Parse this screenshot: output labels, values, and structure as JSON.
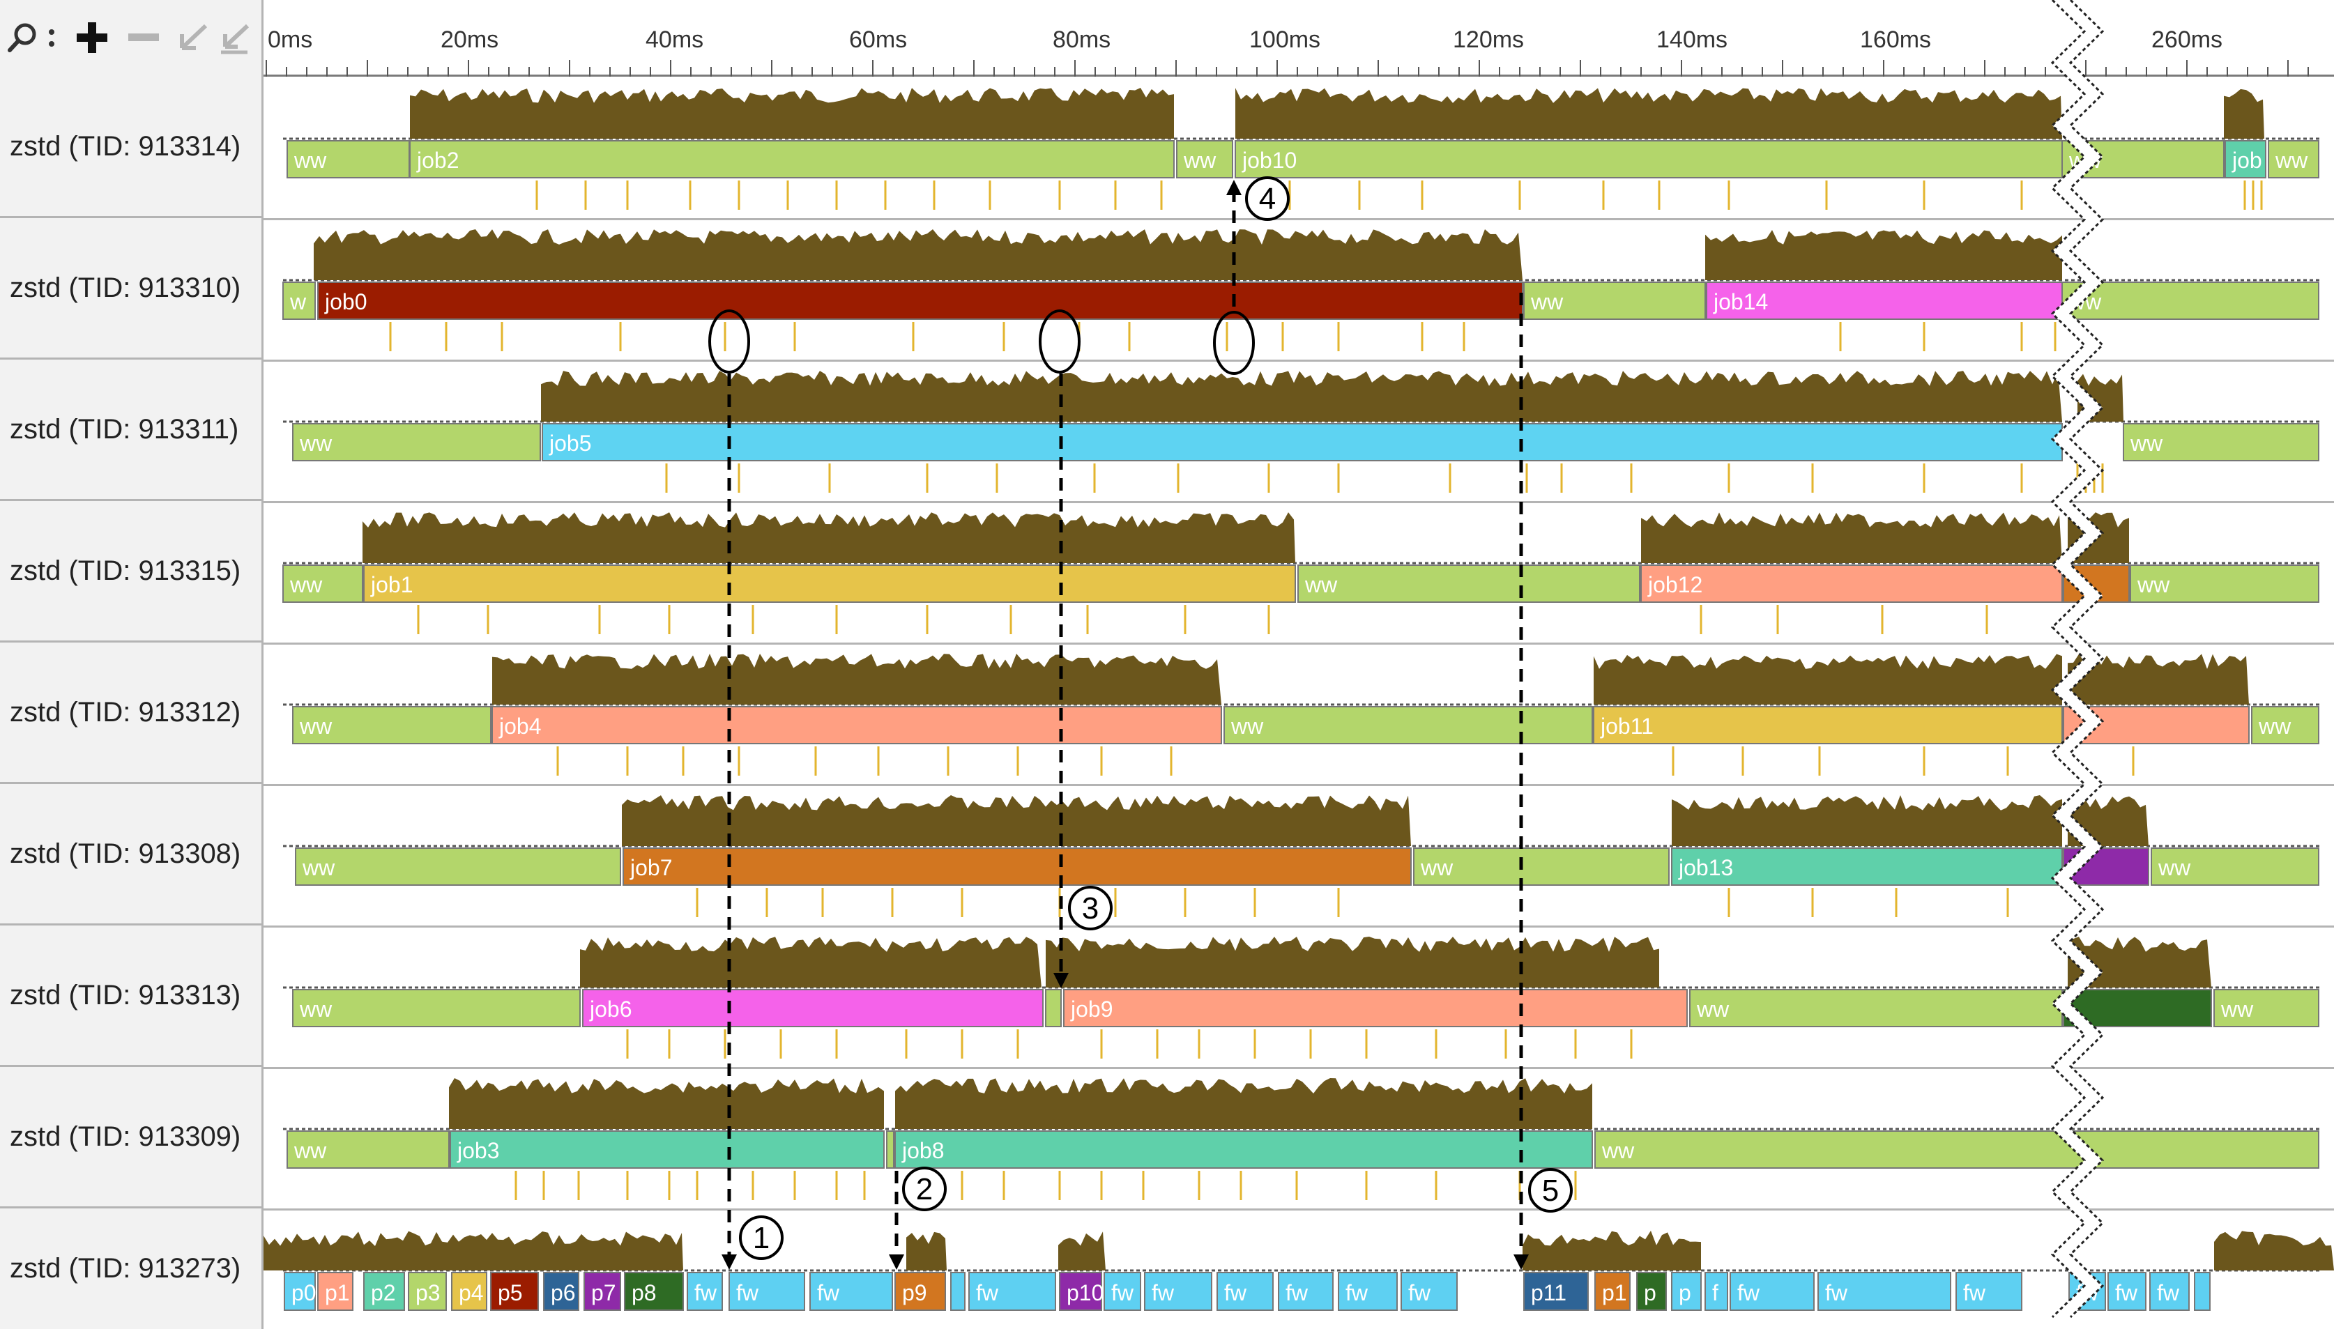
{
  "toolbar": {
    "tools": [
      {
        "name": "search-icon"
      },
      {
        "name": "colon-icon"
      },
      {
        "name": "zoom-in-icon"
      },
      {
        "name": "zoom-out-icon"
      },
      {
        "name": "undo-zoom-icon"
      },
      {
        "name": "reset-zoom-icon"
      }
    ]
  },
  "ruler": {
    "ticks": [
      "0ms",
      "20ms",
      "40ms",
      "60ms",
      "80ms",
      "100ms",
      "120ms",
      "140ms",
      "160ms",
      "260ms"
    ]
  },
  "colors": {
    "ww": "#b3d66b",
    "fw": "#5ed0f2",
    "activity": "#6b561c",
    "event_tick": "#e3b52e",
    "job0": "#9b1c00",
    "job1": "#e6c44a",
    "job2": "#b3d66b",
    "job3": "#5fd0aa",
    "job4": "#ff9f82",
    "job5": "#5ed3f2",
    "job6": "#f562ea",
    "job7": "#d27620",
    "job8": "#5fd0aa",
    "job9": "#ff9f82",
    "job10": "#b3d66b",
    "job11": "#e6c44a",
    "job12": "#ff9f82",
    "job13": "#5fd0aa",
    "job14": "#f562ea"
  },
  "lanes": [
    {
      "label": "zstd (TID: 913314)",
      "segments": [
        {
          "text": "ww",
          "color": "#b3d66b"
        },
        {
          "text": "job2",
          "color": "#b3d66b"
        },
        {
          "text": "ww",
          "color": "#b3d66b"
        },
        {
          "text": "job10",
          "color": "#b3d66b"
        },
        {
          "text": "ww",
          "color": "#b3d66b"
        },
        {
          "text": "job",
          "color": "#5fd0aa"
        },
        {
          "text": "ww",
          "color": "#b3d66b"
        }
      ]
    },
    {
      "label": "zstd (TID: 913310)",
      "segments": [
        {
          "text": "w",
          "color": "#b3d66b"
        },
        {
          "text": "job0",
          "color": "#9b1c00"
        },
        {
          "text": "ww",
          "color": "#b3d66b"
        },
        {
          "text": "job14",
          "color": "#f562ea"
        },
        {
          "text": "ww",
          "color": "#b3d66b"
        }
      ]
    },
    {
      "label": "zstd (TID: 913311)",
      "segments": [
        {
          "text": "ww",
          "color": "#b3d66b"
        },
        {
          "text": "job5",
          "color": "#5ed3f2"
        },
        {
          "text": "ww",
          "color": "#b3d66b"
        }
      ]
    },
    {
      "label": "zstd (TID: 913315)",
      "segments": [
        {
          "text": "ww",
          "color": "#b3d66b"
        },
        {
          "text": "job1",
          "color": "#e6c44a"
        },
        {
          "text": "ww",
          "color": "#b3d66b"
        },
        {
          "text": "job12",
          "color": "#ff9f82"
        },
        {
          "text": "",
          "color": "#d27620"
        },
        {
          "text": "ww",
          "color": "#b3d66b"
        }
      ]
    },
    {
      "label": "zstd (TID: 913312)",
      "segments": [
        {
          "text": "ww",
          "color": "#b3d66b"
        },
        {
          "text": "job4",
          "color": "#ff9f82"
        },
        {
          "text": "ww",
          "color": "#b3d66b"
        },
        {
          "text": "job11",
          "color": "#e6c44a"
        },
        {
          "text": "",
          "color": "#ff9f82"
        },
        {
          "text": "ww",
          "color": "#b3d66b"
        }
      ]
    },
    {
      "label": "zstd (TID: 913308)",
      "segments": [
        {
          "text": "ww",
          "color": "#b3d66b"
        },
        {
          "text": "job7",
          "color": "#d27620"
        },
        {
          "text": "ww",
          "color": "#b3d66b"
        },
        {
          "text": "job13",
          "color": "#5fd0aa"
        },
        {
          "text": "",
          "color": "#8e2aa8"
        },
        {
          "text": "ww",
          "color": "#b3d66b"
        }
      ]
    },
    {
      "label": "zstd (TID: 913313)",
      "segments": [
        {
          "text": "ww",
          "color": "#b3d66b"
        },
        {
          "text": "job6",
          "color": "#f562ea"
        },
        {
          "text": "",
          "color": "#b3d66b"
        },
        {
          "text": "job9",
          "color": "#ff9f82"
        },
        {
          "text": "ww",
          "color": "#b3d66b"
        },
        {
          "text": "",
          "color": "#2e6b24"
        },
        {
          "text": "ww",
          "color": "#b3d66b"
        }
      ]
    },
    {
      "label": "zstd (TID: 913309)",
      "segments": [
        {
          "text": "ww",
          "color": "#b3d66b"
        },
        {
          "text": "job3",
          "color": "#5fd0aa"
        },
        {
          "text": "",
          "color": "#b3d66b"
        },
        {
          "text": "job8",
          "color": "#5fd0aa"
        },
        {
          "text": "ww",
          "color": "#b3d66b"
        }
      ]
    },
    {
      "label": "zstd (TID: 913273)",
      "segments": [
        {
          "text": "p0",
          "color": "#5ed0f2"
        },
        {
          "text": "p1",
          "color": "#ff9f82"
        },
        {
          "text": "p2",
          "color": "#5fd0aa"
        },
        {
          "text": "p3",
          "color": "#b3d66b"
        },
        {
          "text": "p4",
          "color": "#e6c44a"
        },
        {
          "text": "p5",
          "color": "#9b1c00"
        },
        {
          "text": "p6",
          "color": "#2e6496"
        },
        {
          "text": "p7",
          "color": "#8e2aa8"
        },
        {
          "text": "p8",
          "color": "#2e6b24"
        },
        {
          "text": "fw",
          "color": "#5ed0f2"
        },
        {
          "text": "fw",
          "color": "#5ed0f2"
        },
        {
          "text": "fw",
          "color": "#5ed0f2"
        },
        {
          "text": "p9",
          "color": "#d27620"
        },
        {
          "text": "",
          "color": "#5ed0f2"
        },
        {
          "text": "fw",
          "color": "#5ed0f2"
        },
        {
          "text": "p10",
          "color": "#8e2aa8"
        },
        {
          "text": "fw",
          "color": "#5ed0f2"
        },
        {
          "text": "fw",
          "color": "#5ed0f2"
        },
        {
          "text": "fw",
          "color": "#5ed0f2"
        },
        {
          "text": "fw",
          "color": "#5ed0f2"
        },
        {
          "text": "fw",
          "color": "#5ed0f2"
        },
        {
          "text": "fw",
          "color": "#5ed0f2"
        },
        {
          "text": "p11",
          "color": "#2e6496"
        },
        {
          "text": "p1",
          "color": "#d27620"
        },
        {
          "text": "p",
          "color": "#2e6b24"
        },
        {
          "text": "p",
          "color": "#5ed0f2"
        },
        {
          "text": "f",
          "color": "#5ed0f2"
        },
        {
          "text": "fw",
          "color": "#5ed0f2"
        },
        {
          "text": "fw",
          "color": "#5ed0f2"
        },
        {
          "text": "fw",
          "color": "#5ed0f2"
        },
        {
          "text": "fw",
          "color": "#5ed0f2"
        },
        {
          "text": "fw",
          "color": "#5ed0f2"
        },
        {
          "text": "fw",
          "color": "#5ed0f2"
        },
        {
          "text": "",
          "color": "#5ed0f2"
        }
      ]
    }
  ],
  "annotations": [
    {
      "label": "1"
    },
    {
      "label": "2"
    },
    {
      "label": "3"
    },
    {
      "label": "4"
    },
    {
      "label": "5"
    }
  ]
}
